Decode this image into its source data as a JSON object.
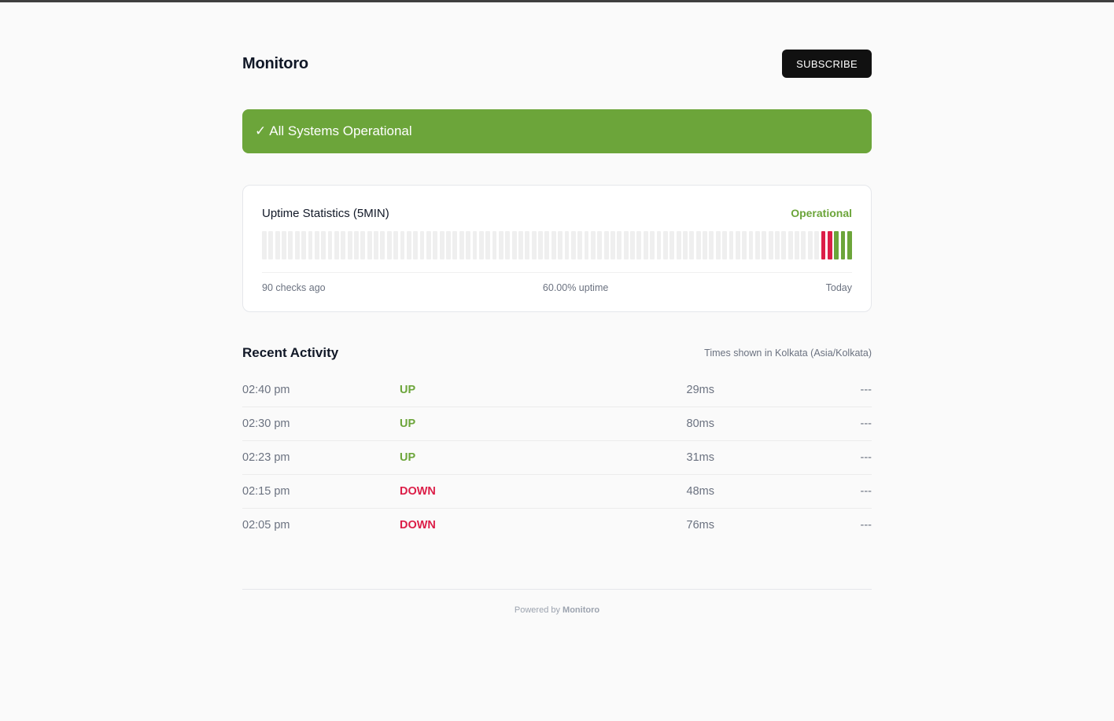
{
  "header": {
    "brand": "Monitoro",
    "subscribe_label": "SUBSCRIBE"
  },
  "banner": {
    "check": "✓",
    "text": "All Systems Operational",
    "color": "#6ca53a"
  },
  "uptime": {
    "title": "Uptime Statistics (5MIN)",
    "status": "Operational",
    "total_checks": 90,
    "checks": [
      "down",
      "down",
      "up",
      "up",
      "up"
    ],
    "left_label": "90 checks ago",
    "center_label": "60.00% uptime",
    "right_label": "Today",
    "colors": {
      "up": "#6ca53a",
      "down": "#dc1e48",
      "empty": "#efefef"
    }
  },
  "activity": {
    "title": "Recent Activity",
    "timezone_note": "Times shown in Kolkata (Asia/Kolkata)",
    "rows": [
      {
        "time": "02:40 pm",
        "status": "UP",
        "response": "29ms",
        "extra": "---"
      },
      {
        "time": "02:30 pm",
        "status": "UP",
        "response": "80ms",
        "extra": "---"
      },
      {
        "time": "02:23 pm",
        "status": "UP",
        "response": "31ms",
        "extra": "---"
      },
      {
        "time": "02:15 pm",
        "status": "DOWN",
        "response": "48ms",
        "extra": "---"
      },
      {
        "time": "02:05 pm",
        "status": "DOWN",
        "response": "76ms",
        "extra": "---"
      }
    ]
  },
  "footer": {
    "prefix": "Powered by",
    "brand": "Monitoro"
  }
}
